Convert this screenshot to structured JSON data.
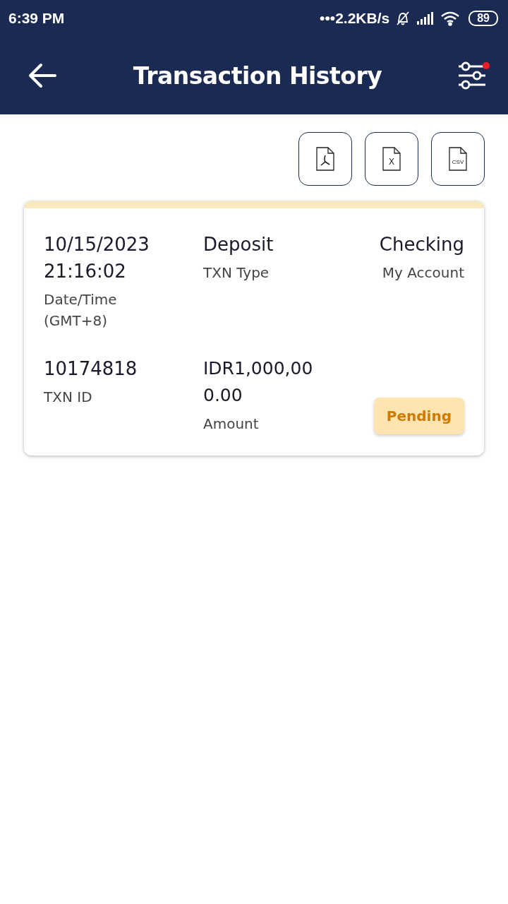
{
  "status_bar": {
    "time": "6:39 PM",
    "network_speed": "•••2.2KB/s",
    "battery": "89"
  },
  "header": {
    "title": "Transaction History",
    "filter_has_badge": true
  },
  "export_buttons": [
    {
      "kind": "pdf"
    },
    {
      "kind": "excel",
      "label": "X"
    },
    {
      "kind": "csv",
      "label": "CSV"
    }
  ],
  "transactions": [
    {
      "fields": [
        {
          "value": "10/15/2023 21:16:02",
          "label": "Date/Time (GMT+8)"
        },
        {
          "value": "Deposit",
          "label": "TXN Type"
        },
        {
          "value": "Checking",
          "label": "My Account"
        },
        {
          "value": "10174818",
          "label": "TXN ID"
        },
        {
          "value": "IDR1,000,000.00",
          "label": "Amount"
        }
      ],
      "status": "Pending"
    }
  ]
}
